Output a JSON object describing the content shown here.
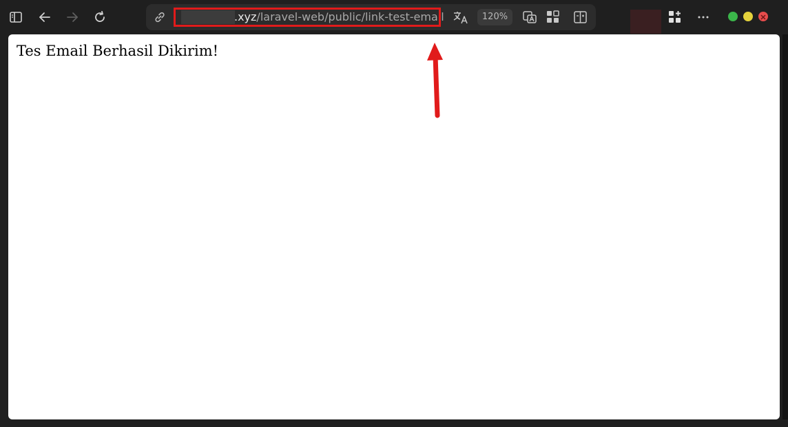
{
  "address_bar": {
    "url_domain_suffix": ".xyz",
    "url_path": "/laravel-web/public/link-test-email",
    "zoom_level": "120%"
  },
  "page": {
    "message": "Tes Email Berhasil Dikirim!"
  },
  "colors": {
    "highlight": "#e11b1b",
    "chrome_bg": "#1f1f1f",
    "page_bg": "#ffffff"
  },
  "icons": {
    "sidebar": "sidebar-toggle-icon",
    "back": "back-arrow-icon",
    "forward": "forward-arrow-icon",
    "refresh": "refresh-icon",
    "site_info": "link-icon",
    "translate": "translate-icon",
    "read_aloud": "read-aloud-icon",
    "apps": "apps-icon",
    "split": "split-screen-icon",
    "extensions": "add-extension-icon",
    "more": "more-icon"
  }
}
